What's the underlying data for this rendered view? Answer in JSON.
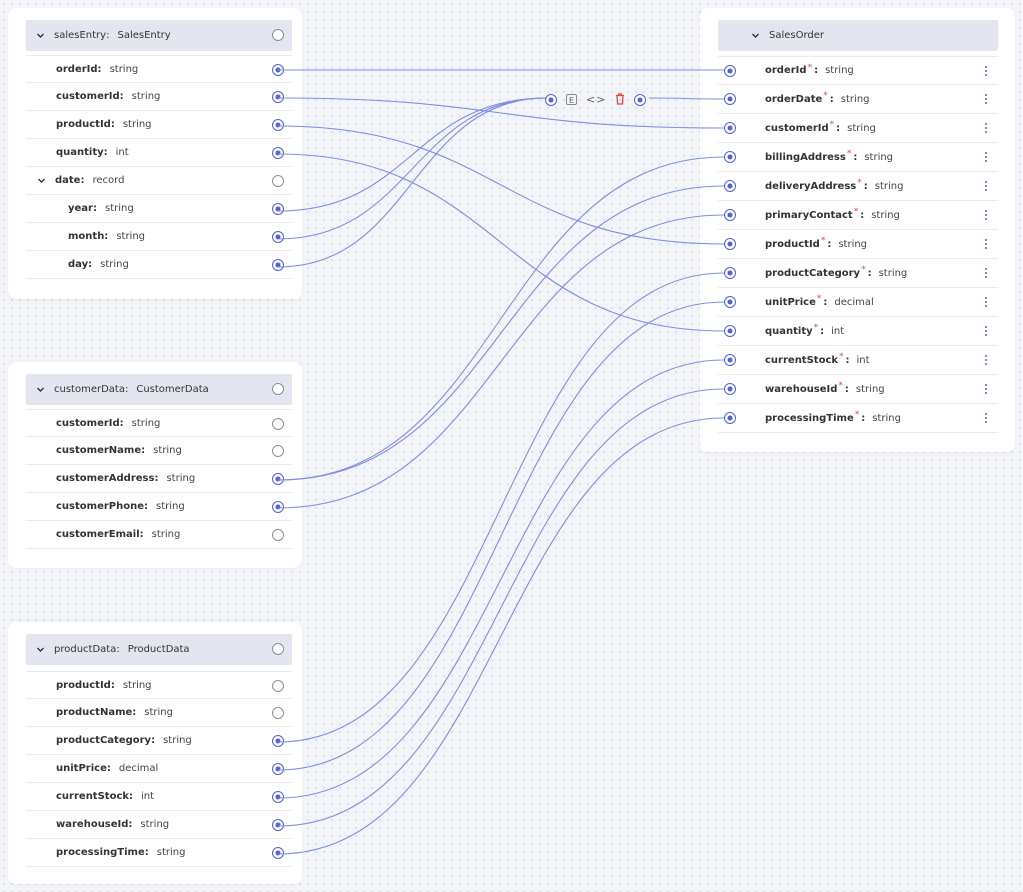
{
  "colors": {
    "accent": "#4e62d6",
    "required": "#e04848",
    "wire": "#7f8fe0"
  },
  "icons": {
    "collapse": "chevron-down-icon",
    "expression": "expression-icon",
    "code": "code-icon",
    "delete": "trash-icon",
    "menu": "kebab-menu-icon"
  },
  "sources": [
    {
      "name": "salesEntry",
      "type": "SalesEntry",
      "fields": [
        {
          "label": "orderId:",
          "type": "string",
          "connected": true
        },
        {
          "label": "customerId:",
          "type": "string",
          "connected": true
        },
        {
          "label": "productId:",
          "type": "string",
          "connected": true
        },
        {
          "label": "quantity:",
          "type": "int",
          "connected": true
        },
        {
          "label": "date:",
          "type": "record",
          "connected": false,
          "expandable": true
        },
        {
          "label": "year:",
          "type": "string",
          "connected": true,
          "nested": true
        },
        {
          "label": "month:",
          "type": "string",
          "connected": true,
          "nested": true
        },
        {
          "label": "day:",
          "type": "string",
          "connected": true,
          "nested": true
        }
      ]
    },
    {
      "name": "customerData",
      "type": "CustomerData",
      "fields": [
        {
          "label": "customerId:",
          "type": "string",
          "connected": false
        },
        {
          "label": "customerName:",
          "type": "string",
          "connected": false
        },
        {
          "label": "customerAddress:",
          "type": "string",
          "connected": true
        },
        {
          "label": "customerPhone:",
          "type": "string",
          "connected": true
        },
        {
          "label": "customerEmail:",
          "type": "string",
          "connected": false
        }
      ]
    },
    {
      "name": "productData",
      "type": "ProductData",
      "fields": [
        {
          "label": "productId:",
          "type": "string",
          "connected": false
        },
        {
          "label": "productName:",
          "type": "string",
          "connected": false
        },
        {
          "label": "productCategory:",
          "type": "string",
          "connected": true
        },
        {
          "label": "unitPrice:",
          "type": "decimal",
          "connected": true
        },
        {
          "label": "currentStock:",
          "type": "int",
          "connected": true
        },
        {
          "label": "warehouseId:",
          "type": "string",
          "connected": true
        },
        {
          "label": "processingTime:",
          "type": "string",
          "connected": true
        }
      ]
    }
  ],
  "target": {
    "name": "SalesOrder",
    "fields": [
      {
        "label": "orderId",
        "type": "string",
        "required": true
      },
      {
        "label": "orderDate",
        "type": "string",
        "required": true
      },
      {
        "label": "customerId",
        "type": "string",
        "required": true
      },
      {
        "label": "billingAddress",
        "type": "string",
        "required": true
      },
      {
        "label": "deliveryAddress",
        "type": "string",
        "required": true
      },
      {
        "label": "primaryContact",
        "type": "string",
        "required": true
      },
      {
        "label": "productId",
        "type": "string",
        "required": true
      },
      {
        "label": "productCategory",
        "type": "string",
        "required": true
      },
      {
        "label": "unitPrice",
        "type": "decimal",
        "required": true
      },
      {
        "label": "quantity",
        "type": "int",
        "required": true
      },
      {
        "label": "currentStock",
        "type": "int",
        "required": true
      },
      {
        "label": "warehouseId",
        "type": "string",
        "required": true
      },
      {
        "label": "processingTime",
        "type": "string",
        "required": true
      }
    ]
  },
  "expression_node": {
    "expression_label": "E",
    "code_label": "<>"
  },
  "mappings": [
    {
      "from": "salesEntry.orderId",
      "to": "orderId"
    },
    {
      "from": "salesEntry.customerId",
      "to": "customerId"
    },
    {
      "from": "salesEntry.productId",
      "to": "productId"
    },
    {
      "from": "salesEntry.quantity",
      "to": "quantity"
    },
    {
      "from": "salesEntry.date.year",
      "to": "expression"
    },
    {
      "from": "salesEntry.date.month",
      "to": "expression"
    },
    {
      "from": "salesEntry.date.day",
      "to": "expression"
    },
    {
      "from": "expression",
      "to": "orderDate"
    },
    {
      "from": "customerData.customerAddress",
      "to": "billingAddress"
    },
    {
      "from": "customerData.customerAddress",
      "to": "deliveryAddress"
    },
    {
      "from": "customerData.customerPhone",
      "to": "primaryContact"
    },
    {
      "from": "productData.productCategory",
      "to": "productCategory"
    },
    {
      "from": "productData.unitPrice",
      "to": "unitPrice"
    },
    {
      "from": "productData.currentStock",
      "to": "currentStock"
    },
    {
      "from": "productData.warehouseId",
      "to": "warehouseId"
    },
    {
      "from": "productData.processingTime",
      "to": "processingTime"
    }
  ]
}
